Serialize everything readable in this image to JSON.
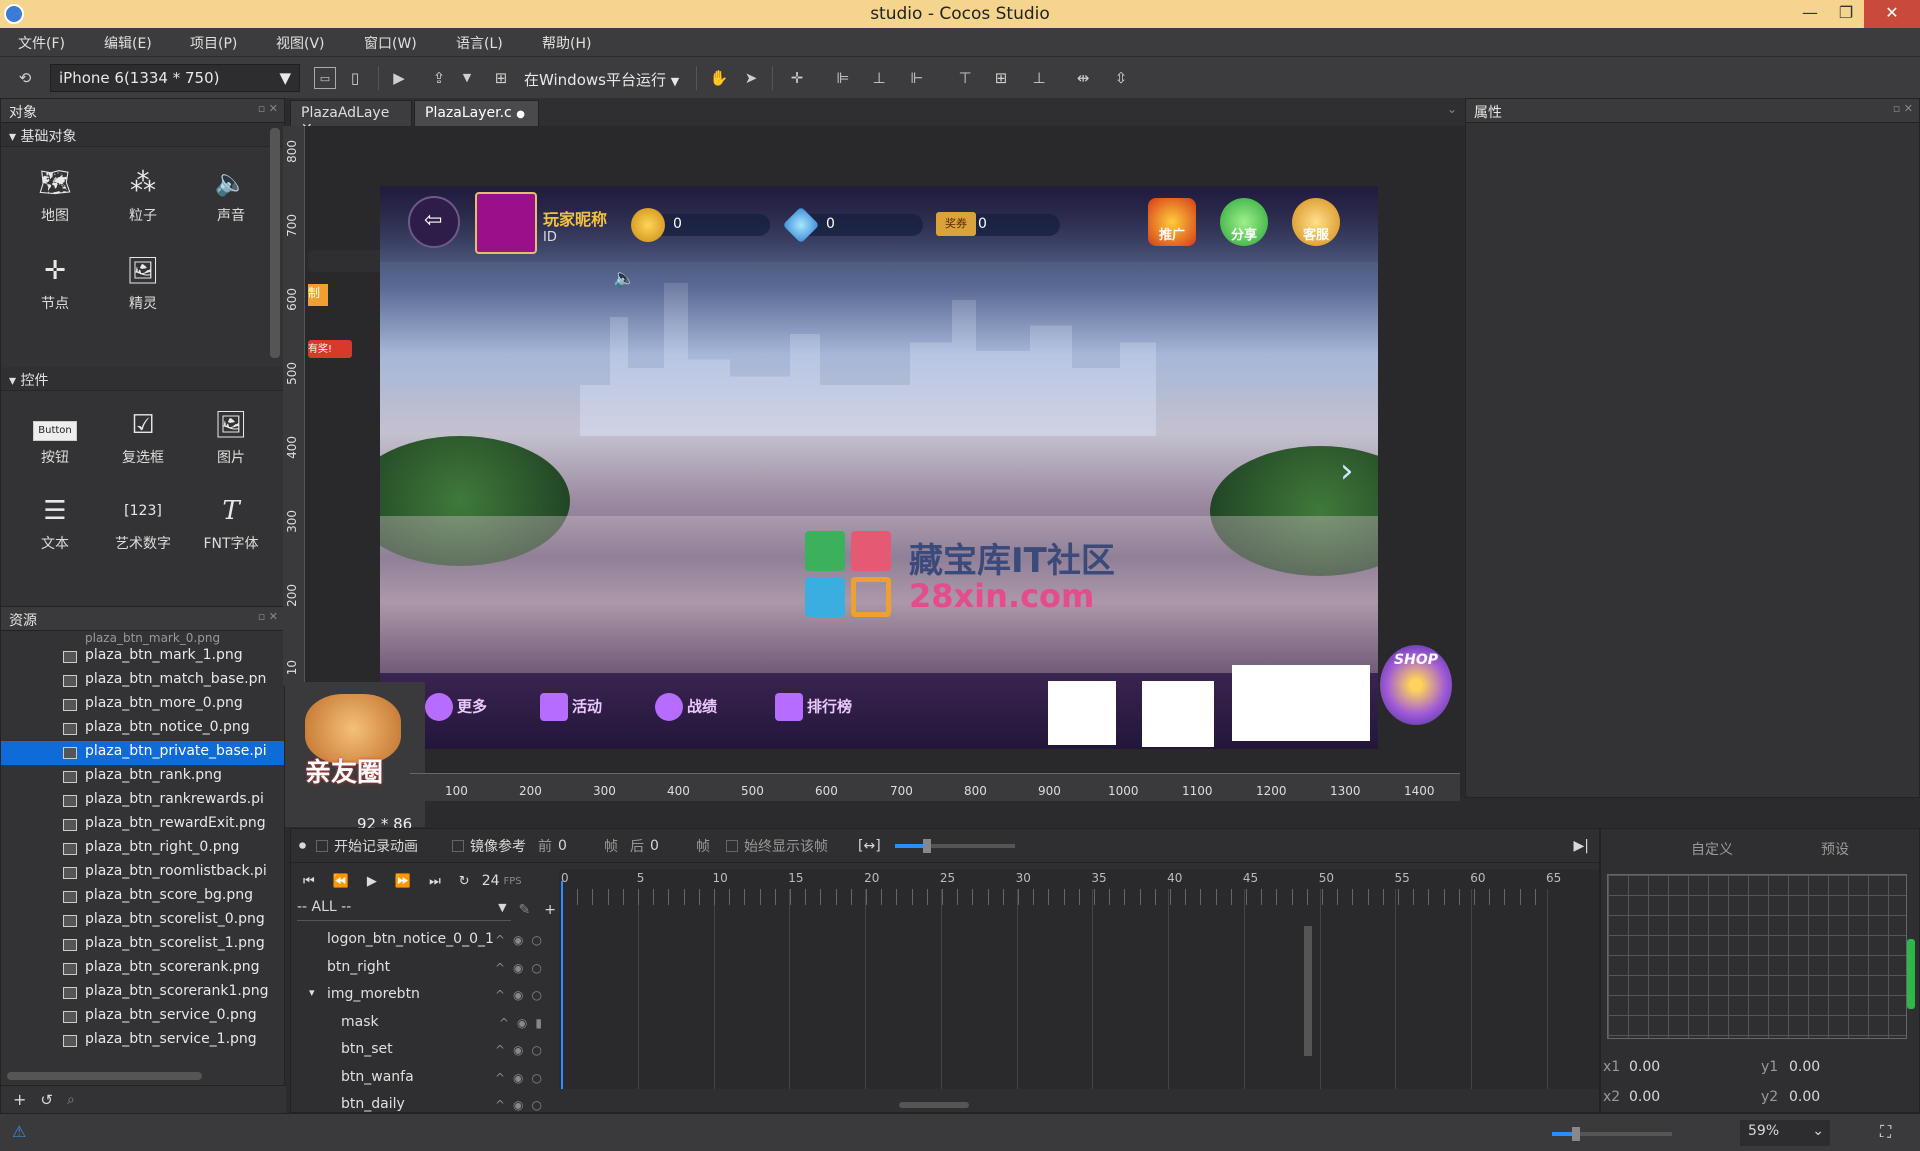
{
  "window": {
    "title": "studio - Cocos Studio",
    "min": "—",
    "max": "❐",
    "close": "✕"
  },
  "menu": [
    "文件(F)",
    "编辑(E)",
    "项目(P)",
    "视图(V)",
    "窗口(W)",
    "语言(L)",
    "帮助(H)"
  ],
  "toolbar": {
    "device": "iPhone 6(1334 * 750)",
    "run_label": "在Windows平台运行"
  },
  "objects_panel": {
    "title": "对象",
    "basic_section": "基础对象",
    "basic_items": [
      {
        "label": "地图",
        "icon": "map-icon"
      },
      {
        "label": "粒子",
        "icon": "particle-icon"
      },
      {
        "label": "声音",
        "icon": "sound-icon"
      },
      {
        "label": "节点",
        "icon": "node-icon"
      },
      {
        "label": "精灵",
        "icon": "sprite-icon"
      }
    ],
    "controls_section": "控件",
    "control_items": [
      {
        "label": "按钮",
        "icon": "button-icon"
      },
      {
        "label": "复选框",
        "icon": "checkbox-icon"
      },
      {
        "label": "图片",
        "icon": "image-icon"
      },
      {
        "label": "文本",
        "icon": "text-icon"
      },
      {
        "label": "艺术数字",
        "icon": "art-number-icon"
      },
      {
        "label": "FNT字体",
        "icon": "fnt-font-icon"
      }
    ],
    "button_widget_text": "Button",
    "art_number_text": "123"
  },
  "resources_panel": {
    "title": "资源",
    "files": [
      "plaza_btn_mark_1.png",
      "plaza_btn_match_base.pn",
      "plaza_btn_more_0.png",
      "plaza_btn_notice_0.png",
      "plaza_btn_private_base.pi",
      "plaza_btn_rank.png",
      "plaza_btn_rankrewards.pi",
      "plaza_btn_rewardExit.png",
      "plaza_btn_right_0.png",
      "plaza_btn_roomlistback.pi",
      "plaza_btn_score_bg.png",
      "plaza_btn_scorelist_0.png",
      "plaza_btn_scorelist_1.png",
      "plaza_btn_scorerank.png",
      "plaza_btn_scorerank1.png",
      "plaza_btn_service_0.png",
      "plaza_btn_service_1.png"
    ],
    "selected_index": 4
  },
  "tabs": [
    {
      "label": "PlazaAdLaye",
      "mark": "✕"
    },
    {
      "label": "PlazaLayer.c",
      "mark": "●"
    }
  ],
  "ruler_v": [
    "800",
    "700",
    "600",
    "500",
    "400",
    "300",
    "200",
    "10"
  ],
  "ruler_h": [
    "100",
    "200",
    "300",
    "400",
    "500",
    "600",
    "700",
    "800",
    "900",
    "1000",
    "1100",
    "1200",
    "1300",
    "1400"
  ],
  "game": {
    "nickname": "玩家昵称",
    "id_label": "ID",
    "coins": "0",
    "diamonds": "0",
    "tickets": "0",
    "ticket_tag": "奖券",
    "top_icons": [
      "推广",
      "分享",
      "客服"
    ],
    "bottom_nav": [
      "更多",
      "活动",
      "战绩",
      "排行榜"
    ],
    "shop": "SHOP",
    "side_tag_1": "制",
    "side_tag_2": "有奖!"
  },
  "watermark": {
    "line1": "藏宝库IT社区",
    "line2": "28xin.com"
  },
  "friend_preview": {
    "label": "亲友圈",
    "size": "92 * 86"
  },
  "properties_panel": {
    "title": "属性"
  },
  "timeline": {
    "record_label": "开始记录动画",
    "mirror_label": "镜像参考",
    "before_label": "前",
    "before_value": "0",
    "frame_unit": "帧",
    "after_label": "后",
    "after_value": "0",
    "always_show_label": "始终显示该帧",
    "fps": "24",
    "fps_unit": "FPS",
    "filter": "-- ALL --",
    "frame_numbers": [
      "0",
      "5",
      "10",
      "15",
      "20",
      "25",
      "30",
      "35",
      "40",
      "45",
      "50",
      "55",
      "60",
      "65"
    ],
    "nodes": [
      {
        "name": "logon_btn_notice_0_0_1",
        "indent": 1
      },
      {
        "name": "btn_right",
        "indent": 1
      },
      {
        "name": "img_morebtn",
        "indent": 1,
        "expanded": true
      },
      {
        "name": "mask",
        "indent": 2,
        "locked": true
      },
      {
        "name": "btn_set",
        "indent": 2
      },
      {
        "name": "btn_wanfa",
        "indent": 2
      },
      {
        "name": "btn_daily",
        "indent": 2
      }
    ]
  },
  "curve_panel": {
    "custom_tab": "自定义",
    "preset_tab": "预设",
    "x1_label": "x1",
    "x1": "0.00",
    "y1_label": "y1",
    "y1": "0.00",
    "x2_label": "x2",
    "x2": "0.00",
    "y2_label": "y2",
    "y2": "0.00"
  },
  "status": {
    "zoom": "59%"
  },
  "colors": {
    "selection": "#0f6bd8",
    "titlebar": "#f5d48e",
    "close": "#c94a3c",
    "playhead": "#2f8cff"
  }
}
